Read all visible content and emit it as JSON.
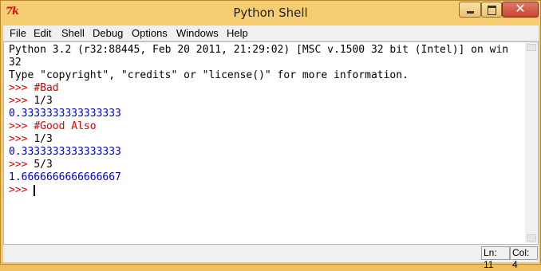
{
  "window": {
    "title": "Python Shell",
    "icon": "7k"
  },
  "menu": [
    "File",
    "Edit",
    "Shell",
    "Debug",
    "Options",
    "Windows",
    "Help"
  ],
  "shell": {
    "lines": [
      {
        "text": "Python 3.2 (r32:88445, Feb 20 2011, 21:29:02) [MSC v.1500 32 bit (Intel)] on win",
        "color": "black"
      },
      {
        "text": "32",
        "color": "black"
      },
      {
        "text": "Type \"copyright\", \"credits\" or \"license()\" for more information.",
        "color": "black"
      },
      {
        "prompt": ">>> ",
        "text": "#Bad",
        "color": "red"
      },
      {
        "prompt": ">>> ",
        "text": "1/3",
        "color": "black"
      },
      {
        "text": "0.3333333333333333",
        "color": "blue"
      },
      {
        "prompt": ">>> ",
        "text": "#Good Also",
        "color": "red"
      },
      {
        "prompt": ">>> ",
        "text": "1/3",
        "color": "black"
      },
      {
        "text": "0.3333333333333333",
        "color": "blue"
      },
      {
        "prompt": ">>> ",
        "text": "5/3",
        "color": "black"
      },
      {
        "text": "1.6666666666666667",
        "color": "blue"
      },
      {
        "prompt": ">>> ",
        "text": "",
        "color": "black"
      }
    ]
  },
  "status": {
    "line": "Ln: 11",
    "col": "Col: 4"
  }
}
